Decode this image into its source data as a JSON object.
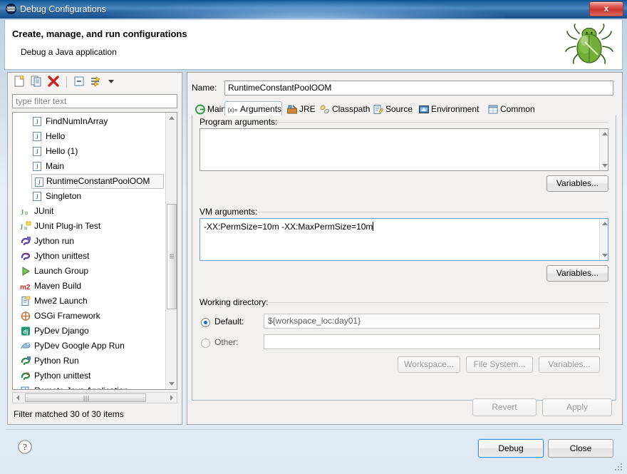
{
  "window": {
    "title": "Debug Configurations",
    "close_label": "x",
    "titlebar_icon": "eclipse-launch-icon",
    "header_title": "Create, manage, and run configurations",
    "header_subtitle": "Debug a Java application",
    "header_icon": "green-bug-icon"
  },
  "colors": {
    "titlebar_start": "#0a4f8f",
    "titlebar_end": "#184f8c",
    "close_red": "#c9332b",
    "accent_blue": "#1a6fc4",
    "default_button_border": "#3c8ad0",
    "bug_green": "#6fae3d"
  },
  "left_panel": {
    "toolbar": [
      {
        "name": "new-launch-configuration-button",
        "icon": "new-document-icon"
      },
      {
        "name": "duplicate-launch-configuration-button",
        "icon": "copy-icon"
      },
      {
        "name": "delete-launch-configuration-button",
        "icon": "red-x-delete-icon"
      },
      {
        "name": "collapse-all-button",
        "icon": "collapse-all-icon"
      },
      {
        "name": "filter-button",
        "icon": "filter-icon"
      },
      {
        "name": "view-menu-button",
        "icon": "chevron-down-icon"
      }
    ],
    "filter": {
      "placeholder": "type filter text",
      "value": ""
    },
    "tree": [
      {
        "label": "FindNumInArray",
        "icon": "java-app-icon",
        "level": 1,
        "selected": false
      },
      {
        "label": "Hello",
        "icon": "java-app-icon",
        "level": 1,
        "selected": false
      },
      {
        "label": "Hello (1)",
        "icon": "java-app-icon",
        "level": 1,
        "selected": false
      },
      {
        "label": "Main",
        "icon": "java-app-icon",
        "level": 1,
        "selected": false
      },
      {
        "label": "RuntimeConstantPoolOOM",
        "icon": "java-app-icon",
        "level": 1,
        "selected": true
      },
      {
        "label": "Singleton",
        "icon": "java-app-icon",
        "level": 1,
        "selected": false
      },
      {
        "label": "JUnit",
        "icon": "junit-icon",
        "level": 0,
        "selected": false
      },
      {
        "label": "JUnit Plug-in Test",
        "icon": "junit-plugin-icon",
        "level": 0,
        "selected": false
      },
      {
        "label": "Jython run",
        "icon": "jython-run-icon",
        "level": 0,
        "selected": false
      },
      {
        "label": "Jython unittest",
        "icon": "jython-unittest-icon",
        "level": 0,
        "selected": false
      },
      {
        "label": "Launch Group",
        "icon": "green-play-icon",
        "level": 0,
        "selected": false
      },
      {
        "label": "Maven Build",
        "icon": "maven-m2-icon",
        "level": 0,
        "selected": false
      },
      {
        "label": "Mwe2 Launch",
        "icon": "mwe2-icon",
        "level": 0,
        "selected": false
      },
      {
        "label": "OSGi Framework",
        "icon": "osgi-icon",
        "level": 0,
        "selected": false
      },
      {
        "label": "PyDev Django",
        "icon": "django-icon",
        "level": 0,
        "selected": false
      },
      {
        "label": "PyDev Google App Run",
        "icon": "google-app-icon",
        "level": 0,
        "selected": false
      },
      {
        "label": "Python Run",
        "icon": "python-run-icon",
        "level": 0,
        "selected": false
      },
      {
        "label": "Python unittest",
        "icon": "python-unittest-icon",
        "level": 0,
        "selected": false
      },
      {
        "label": "Remote Java Application",
        "icon": "remote-java-icon",
        "level": 0,
        "selected": false
      }
    ],
    "status": "Filter matched 30 of 30 items"
  },
  "right_panel": {
    "name_label": "Name:",
    "name_value": "RuntimeConstantPoolOOM",
    "tabs": [
      {
        "label": "Main",
        "icon": "main-tab-icon",
        "active": false
      },
      {
        "label": "Arguments",
        "icon": "arguments-tab-icon",
        "active": true
      },
      {
        "label": "JRE",
        "icon": "jre-tab-icon",
        "active": false
      },
      {
        "label": "Classpath",
        "icon": "classpath-tab-icon",
        "active": false
      },
      {
        "label": "Source",
        "icon": "source-tab-icon",
        "active": false
      },
      {
        "label": "Environment",
        "icon": "environment-tab-icon",
        "active": false
      },
      {
        "label": "Common",
        "icon": "common-tab-icon",
        "active": false
      }
    ],
    "program_arguments": {
      "label": "Program arguments:",
      "value": "",
      "variables_button": "Variables..."
    },
    "vm_arguments": {
      "label": "VM arguments:",
      "value": "-XX:PermSize=10m -XX:MaxPermSize=10m",
      "variables_button": "Variables..."
    },
    "working_directory": {
      "label": "Working directory:",
      "default_label": "Default:",
      "default_value": "${workspace_loc:day01}",
      "default_selected": true,
      "other_label": "Other:",
      "other_value": "",
      "other_selected": false,
      "workspace_button": "Workspace...",
      "file_system_button": "File System...",
      "variables_button": "Variables..."
    },
    "revert_button": "Revert",
    "apply_button": "Apply",
    "revert_enabled": false,
    "apply_enabled": false
  },
  "footer": {
    "help_icon": "help-question-icon",
    "debug_button": "Debug",
    "close_button": "Close"
  }
}
